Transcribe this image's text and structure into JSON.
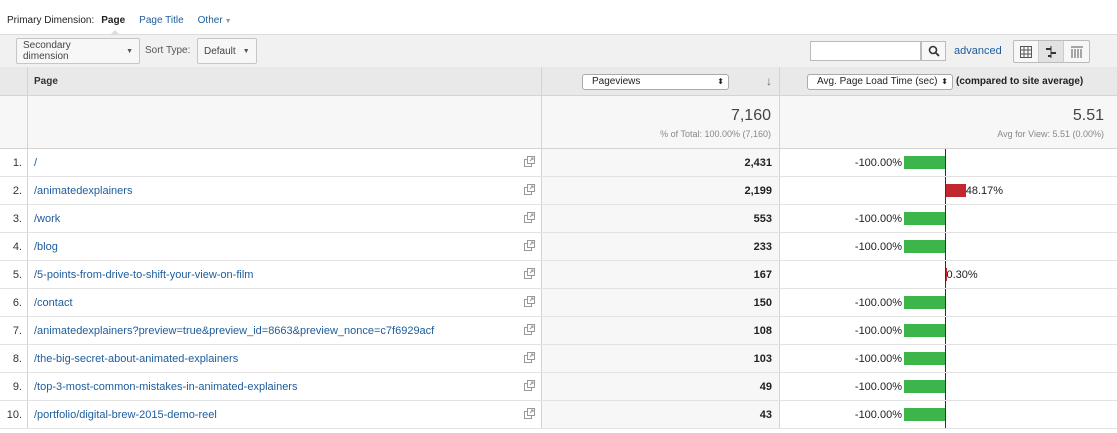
{
  "primary": {
    "label": "Primary Dimension:",
    "active": "Page",
    "options": [
      "Page Title",
      "Other"
    ]
  },
  "toolbar": {
    "secondary_dimension": "Secondary dimension",
    "sort_type_label": "Sort Type:",
    "sort_type_value": "Default",
    "search_value": "",
    "advanced": "advanced"
  },
  "table": {
    "col_page": "Page",
    "col_metric": "Pageviews",
    "col_compare_metric": "Avg. Page Load Time (sec)",
    "col_compare_suffix": "(compared to site average)",
    "summary": {
      "pageviews": "7,160",
      "pageviews_sub": "% of Total: 100.00% (7,160)",
      "load": "5.51",
      "load_sub": "Avg for View: 5.51 (0.00%)"
    },
    "rows": [
      {
        "n": "1.",
        "page": "/",
        "pv": "2,431",
        "delta": "-100.00%",
        "pct": -100
      },
      {
        "n": "2.",
        "page": "/animatedexplainers",
        "pv": "2,199",
        "delta": "48.17%",
        "pct": 48.17
      },
      {
        "n": "3.",
        "page": "/work",
        "pv": "553",
        "delta": "-100.00%",
        "pct": -100
      },
      {
        "n": "4.",
        "page": "/blog",
        "pv": "233",
        "delta": "-100.00%",
        "pct": -100
      },
      {
        "n": "5.",
        "page": "/5-points-from-drive-to-shift-your-view-on-film",
        "pv": "167",
        "delta": "0.30%",
        "pct": 0.3
      },
      {
        "n": "6.",
        "page": "/contact",
        "pv": "150",
        "delta": "-100.00%",
        "pct": -100
      },
      {
        "n": "7.",
        "page": "/animatedexplainers?preview=true&preview_id=8663&preview_nonce=c7f6929acf",
        "pv": "108",
        "delta": "-100.00%",
        "pct": -100
      },
      {
        "n": "8.",
        "page": "/the-big-secret-about-animated-explainers",
        "pv": "103",
        "delta": "-100.00%",
        "pct": -100
      },
      {
        "n": "9.",
        "page": "/top-3-most-common-mistakes-in-animated-explainers",
        "pv": "49",
        "delta": "-100.00%",
        "pct": -100
      },
      {
        "n": "10.",
        "page": "/portfolio/digital-brew-2015-demo-reel",
        "pv": "43",
        "delta": "-100.00%",
        "pct": -100
      }
    ]
  },
  "colors": {
    "link": "#1c5c9c",
    "negative_bar": "#3cb54a",
    "positive_bar": "#c1272d"
  }
}
